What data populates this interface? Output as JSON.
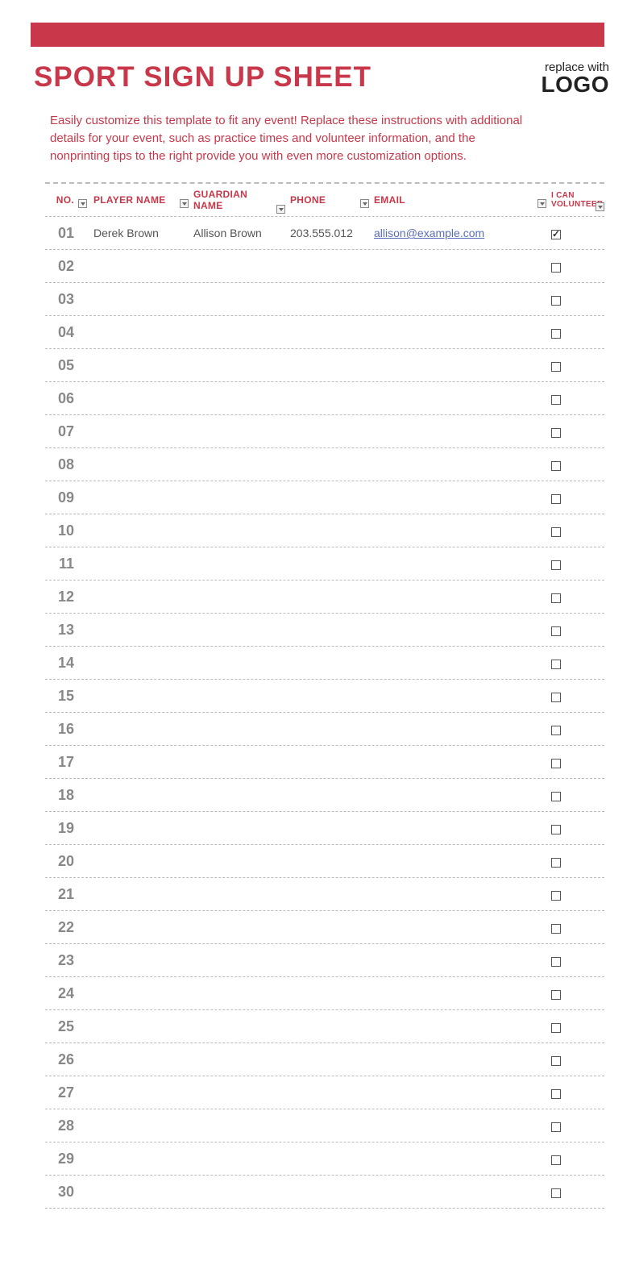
{
  "colors": {
    "accent": "#c8384a"
  },
  "header": {
    "title": "SPORT SIGN UP SHEET",
    "logo_top": "replace with",
    "logo_bottom": "LOGO"
  },
  "instructions": "Easily customize this template to fit any event! Replace these instructions with additional details for your event, such as practice times and volunteer information, and the nonprinting tips to the right provide you with even more customization options.",
  "table": {
    "headers": {
      "no": "NO.",
      "player": "PLAYER NAME",
      "guardian": "GUARDIAN NAME",
      "phone": "PHONE",
      "email": "EMAIL",
      "volunteer": "I CAN VOLUNTEER"
    },
    "rows": [
      {
        "no": "01",
        "player": "Derek Brown",
        "guardian": "Allison Brown",
        "phone": "203.555.012",
        "email": "allison@example.com",
        "volunteer": true
      },
      {
        "no": "02",
        "player": "",
        "guardian": "",
        "phone": "",
        "email": "",
        "volunteer": false
      },
      {
        "no": "03",
        "player": "",
        "guardian": "",
        "phone": "",
        "email": "",
        "volunteer": false
      },
      {
        "no": "04",
        "player": "",
        "guardian": "",
        "phone": "",
        "email": "",
        "volunteer": false
      },
      {
        "no": "05",
        "player": "",
        "guardian": "",
        "phone": "",
        "email": "",
        "volunteer": false
      },
      {
        "no": "06",
        "player": "",
        "guardian": "",
        "phone": "",
        "email": "",
        "volunteer": false
      },
      {
        "no": "07",
        "player": "",
        "guardian": "",
        "phone": "",
        "email": "",
        "volunteer": false
      },
      {
        "no": "08",
        "player": "",
        "guardian": "",
        "phone": "",
        "email": "",
        "volunteer": false
      },
      {
        "no": "09",
        "player": "",
        "guardian": "",
        "phone": "",
        "email": "",
        "volunteer": false
      },
      {
        "no": "10",
        "player": "",
        "guardian": "",
        "phone": "",
        "email": "",
        "volunteer": false
      },
      {
        "no": "11",
        "player": "",
        "guardian": "",
        "phone": "",
        "email": "",
        "volunteer": false
      },
      {
        "no": "12",
        "player": "",
        "guardian": "",
        "phone": "",
        "email": "",
        "volunteer": false
      },
      {
        "no": "13",
        "player": "",
        "guardian": "",
        "phone": "",
        "email": "",
        "volunteer": false
      },
      {
        "no": "14",
        "player": "",
        "guardian": "",
        "phone": "",
        "email": "",
        "volunteer": false
      },
      {
        "no": "15",
        "player": "",
        "guardian": "",
        "phone": "",
        "email": "",
        "volunteer": false
      },
      {
        "no": "16",
        "player": "",
        "guardian": "",
        "phone": "",
        "email": "",
        "volunteer": false
      },
      {
        "no": "17",
        "player": "",
        "guardian": "",
        "phone": "",
        "email": "",
        "volunteer": false
      },
      {
        "no": "18",
        "player": "",
        "guardian": "",
        "phone": "",
        "email": "",
        "volunteer": false
      },
      {
        "no": "19",
        "player": "",
        "guardian": "",
        "phone": "",
        "email": "",
        "volunteer": false
      },
      {
        "no": "20",
        "player": "",
        "guardian": "",
        "phone": "",
        "email": "",
        "volunteer": false
      },
      {
        "no": "21",
        "player": "",
        "guardian": "",
        "phone": "",
        "email": "",
        "volunteer": false
      },
      {
        "no": "22",
        "player": "",
        "guardian": "",
        "phone": "",
        "email": "",
        "volunteer": false
      },
      {
        "no": "23",
        "player": "",
        "guardian": "",
        "phone": "",
        "email": "",
        "volunteer": false
      },
      {
        "no": "24",
        "player": "",
        "guardian": "",
        "phone": "",
        "email": "",
        "volunteer": false
      },
      {
        "no": "25",
        "player": "",
        "guardian": "",
        "phone": "",
        "email": "",
        "volunteer": false
      },
      {
        "no": "26",
        "player": "",
        "guardian": "",
        "phone": "",
        "email": "",
        "volunteer": false
      },
      {
        "no": "27",
        "player": "",
        "guardian": "",
        "phone": "",
        "email": "",
        "volunteer": false
      },
      {
        "no": "28",
        "player": "",
        "guardian": "",
        "phone": "",
        "email": "",
        "volunteer": false
      },
      {
        "no": "29",
        "player": "",
        "guardian": "",
        "phone": "",
        "email": "",
        "volunteer": false
      },
      {
        "no": "30",
        "player": "",
        "guardian": "",
        "phone": "",
        "email": "",
        "volunteer": false
      }
    ]
  }
}
